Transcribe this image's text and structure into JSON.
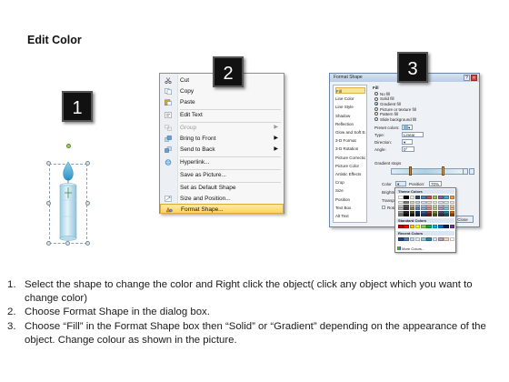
{
  "title": "Edit Color",
  "badges": [
    "1",
    "2",
    "3"
  ],
  "context_menu": {
    "items": [
      {
        "label": "Cut",
        "icon": "scissors-icon"
      },
      {
        "label": "Copy",
        "icon": "copy-icon"
      },
      {
        "label": "Paste",
        "icon": "paste-icon"
      },
      {
        "label": "Edit Text",
        "icon": "edit-text-icon"
      },
      {
        "label": "Group",
        "icon": "group-icon",
        "disabled": true,
        "submenu": true
      },
      {
        "label": "Bring to Front",
        "icon": "bring-front-icon",
        "submenu": true
      },
      {
        "label": "Send to Back",
        "icon": "send-back-icon",
        "submenu": true
      },
      {
        "label": "Hyperlink...",
        "icon": "hyperlink-icon"
      },
      {
        "label": "Save as Picture...",
        "icon": ""
      },
      {
        "label": "Set as Default Shape",
        "icon": ""
      },
      {
        "label": "Size and Position...",
        "icon": "size-position-icon"
      },
      {
        "label": "Format Shape...",
        "icon": "format-shape-icon",
        "highlighted": true
      }
    ]
  },
  "format_dialog": {
    "title": "Format Shape",
    "nav": [
      "Fill",
      "Line Color",
      "Line Style",
      "Shadow",
      "Reflection",
      "Glow and Soft Edges",
      "3-D Format",
      "3-D Rotation",
      "Picture Corrections",
      "Picture Color",
      "Artistic Effects",
      "Crop",
      "Size",
      "Position",
      "Text Box",
      "Alt Text"
    ],
    "section": "Fill",
    "fill_options": [
      {
        "label": "No fill",
        "selected": false
      },
      {
        "label": "Solid fill",
        "selected": false
      },
      {
        "label": "Gradient fill",
        "selected": true
      },
      {
        "label": "Picture or texture fill",
        "selected": false
      },
      {
        "label": "Pattern fill",
        "selected": false
      },
      {
        "label": "Slide background fill",
        "selected": false
      }
    ],
    "preset_colors_label": "Preset colors:",
    "type_label": "Type:",
    "type_value": "Linear",
    "direction_label": "Direction:",
    "angle_label": "Angle:",
    "angle_value": "0°",
    "gradient_stops_label": "Gradient stops",
    "color_label": "Color",
    "position_label": "Position:",
    "position_value": "70%",
    "brightness_label": "Brightness:",
    "transparency_label": "Transparency:",
    "rotate_label": "Rotate with shape",
    "close_label": "Close"
  },
  "color_picker": {
    "theme_label": "Theme Colors",
    "standard_label": "Standard Colors",
    "recent_label": "Recent Colors",
    "more_label": "More Colors...",
    "theme_top": [
      "#ffffff",
      "#000000",
      "#eeece1",
      "#1f497d",
      "#4f81bd",
      "#c0504d",
      "#9bbb59",
      "#8064a2",
      "#4bacc6",
      "#f79646"
    ],
    "theme_tints": [
      [
        "#f2f2f2",
        "#7f7f7f",
        "#ddd9c3",
        "#c6d9f0",
        "#dbe5f1",
        "#f2dcdb",
        "#ebf1dd",
        "#e5e0ec",
        "#dbeef3",
        "#fdeada"
      ],
      [
        "#d8d8d8",
        "#595959",
        "#c4bd97",
        "#8db3e2",
        "#b8cce4",
        "#e5b9b7",
        "#d7e3bc",
        "#ccc1d9",
        "#b7dde8",
        "#fbd5b5"
      ],
      [
        "#bfbfbf",
        "#3f3f3f",
        "#938953",
        "#548dd4",
        "#95b3d7",
        "#d99694",
        "#c3d69b",
        "#b2a2c7",
        "#92cddc",
        "#fac08f"
      ],
      [
        "#a5a5a5",
        "#262626",
        "#494429",
        "#17365d",
        "#366092",
        "#953734",
        "#76923c",
        "#5f497a",
        "#31859b",
        "#e36c09"
      ],
      [
        "#7f7f7f",
        "#0c0c0c",
        "#1d1b10",
        "#0f243e",
        "#244061",
        "#632423",
        "#4f6128",
        "#3f3151",
        "#205867",
        "#974806"
      ]
    ],
    "standard": [
      "#c00000",
      "#ff0000",
      "#ffc000",
      "#ffff00",
      "#92d050",
      "#00b050",
      "#00b0f0",
      "#0070c0",
      "#002060",
      "#7030a0"
    ],
    "recent": [
      "#1f497d",
      "#4f81bd",
      "#c6d9f0",
      "#dbeef3",
      "#92cddc",
      "#31859b",
      "#e5e0ec",
      "#b2a2c7",
      "#fbd5b5",
      "#ffffff"
    ]
  },
  "colors": {
    "candle_body": "#c9e6f2",
    "candle_flame": "#5fb8dc",
    "highlight": "#ffd55c"
  },
  "steps": [
    {
      "num": "1.",
      "text": "Select the shape to change the color and Right click the object( click any object which you want to change color)"
    },
    {
      "num": "2.",
      "text": "Choose Format Shape in the dialog box."
    },
    {
      "num": "3.",
      "text": "Choose “Fill” in the Format Shape box then “Solid” or “Gradient” depending on the appearance of the object. Change colour as shown in the picture."
    }
  ]
}
